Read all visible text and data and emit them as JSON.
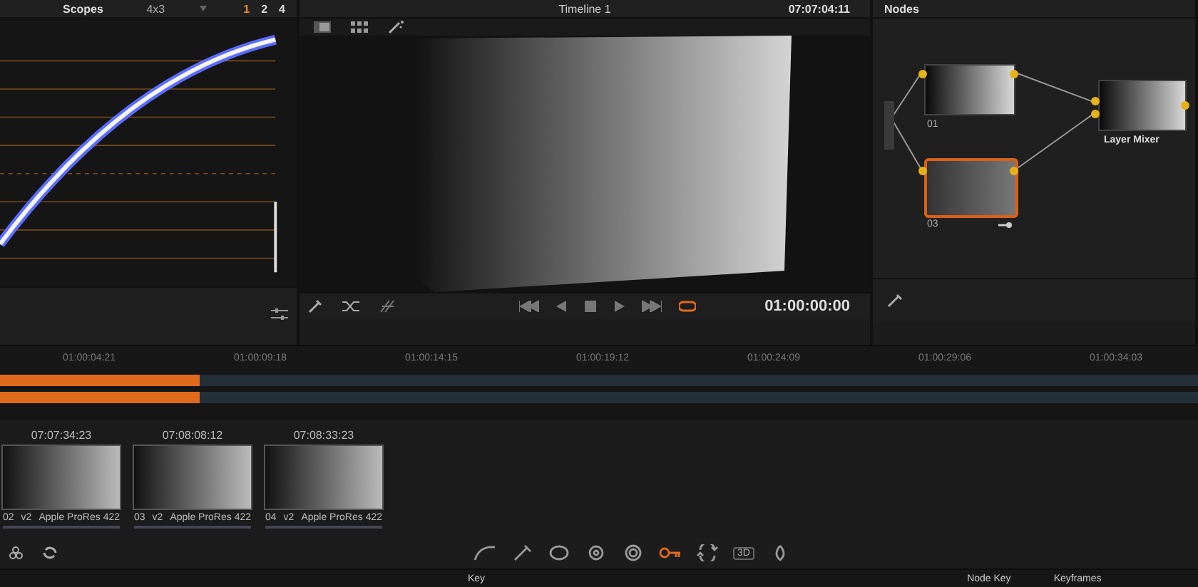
{
  "scopes": {
    "title": "Scopes",
    "aspect": "4x3",
    "layouts": [
      {
        "label": "1",
        "selected": true
      },
      {
        "label": "2",
        "selected": false
      },
      {
        "label": "4",
        "selected": false
      }
    ]
  },
  "viewer": {
    "title": "Timeline 1",
    "timecode": "07:07:04:11",
    "playhead_timecode": "01:00:00:00",
    "loop": true
  },
  "nodes": {
    "title": "Nodes",
    "items": [
      {
        "label": "01",
        "selected": false
      },
      {
        "label": "03",
        "selected": true
      },
      {
        "label": "Layer Mixer",
        "selected": false
      }
    ]
  },
  "timeline": {
    "ruler": [
      "01:00:04:21",
      "01:00:09:18",
      "01:00:14:15",
      "01:00:19:12",
      "01:00:24:09",
      "01:00:29:06",
      "01:00:34:03"
    ]
  },
  "clips": [
    {
      "timecode": "07:07:34:23",
      "index": "02",
      "version": "v2",
      "codec": "Apple ProRes 422"
    },
    {
      "timecode": "07:08:08:12",
      "index": "03",
      "version": "v2",
      "codec": "Apple ProRes 422"
    },
    {
      "timecode": "07:08:33:23",
      "index": "04",
      "version": "v2",
      "codec": "Apple ProRes 422"
    }
  ],
  "tools": [
    {
      "kind": "curve",
      "selected": false
    },
    {
      "kind": "picker",
      "selected": false
    },
    {
      "kind": "window",
      "selected": false
    },
    {
      "kind": "tracker",
      "selected": false
    },
    {
      "kind": "blur",
      "selected": false
    },
    {
      "kind": "key",
      "selected": true
    },
    {
      "kind": "sizing",
      "selected": false
    },
    {
      "kind": "stereo",
      "label": "3D",
      "selected": false
    },
    {
      "kind": "drop",
      "selected": false
    }
  ],
  "bottom": {
    "key": "Key",
    "node_key": "Node Key",
    "keyframes": "Keyframes"
  }
}
